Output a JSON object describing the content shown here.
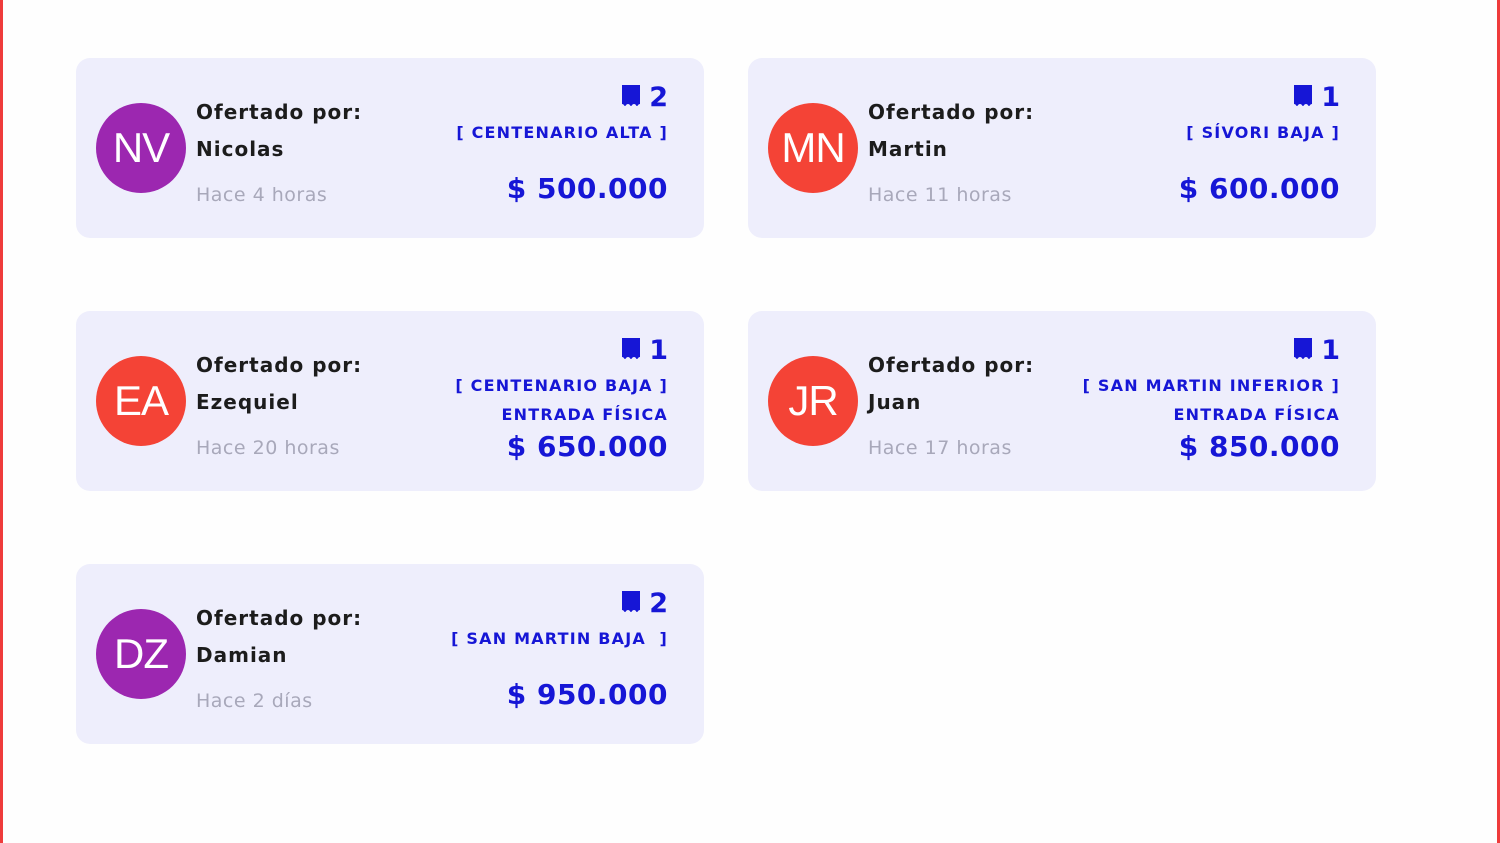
{
  "colors": {
    "accent": "#1616d6",
    "card_background": "#eeeefc",
    "avatar_purple": "#9c27b0",
    "avatar_red": "#f44336",
    "muted_text": "#a8a8ba",
    "page_edge": "#ef3b3b"
  },
  "offers": [
    {
      "label": "Ofertado por:",
      "initials": "NV",
      "avatar_color": "#9c27b0",
      "name": "Nicolas",
      "time": "Hace 4 horas",
      "ticket_icon": "ticket-icon",
      "tickets": "2",
      "sector": "[ CENTENARIO ALTA ]",
      "entry": "",
      "price": "$ 500.000"
    },
    {
      "label": "Ofertado por:",
      "initials": "MN",
      "avatar_color": "#f44336",
      "name": "Martin",
      "time": "Hace 11 horas",
      "ticket_icon": "ticket-icon",
      "tickets": "1",
      "sector": "[ SÍVORI BAJA ]",
      "entry": "",
      "price": "$ 600.000"
    },
    {
      "label": "Ofertado por:",
      "initials": "EA",
      "avatar_color": "#f44336",
      "name": "Ezequiel",
      "time": "Hace 20 horas",
      "ticket_icon": "ticket-icon",
      "tickets": "1",
      "sector": "[ CENTENARIO BAJA ]",
      "entry": "ENTRADA FÍSICA",
      "price": "$ 650.000"
    },
    {
      "label": "Ofertado por:",
      "initials": "JR",
      "avatar_color": "#f44336",
      "name": "Juan",
      "time": "Hace 17 horas",
      "ticket_icon": "ticket-icon",
      "tickets": "1",
      "sector": "[ SAN MARTIN INFERIOR ]",
      "entry": "ENTRADA FÍSICA",
      "price": "$ 850.000"
    },
    {
      "label": "Ofertado por:",
      "initials": "DZ",
      "avatar_color": "#9c27b0",
      "name": "Damian",
      "time": "Hace 2 días",
      "ticket_icon": "ticket-icon",
      "tickets": "2",
      "sector": "[ SAN MARTIN BAJA  ]",
      "entry": "",
      "price": "$ 950.000"
    }
  ]
}
